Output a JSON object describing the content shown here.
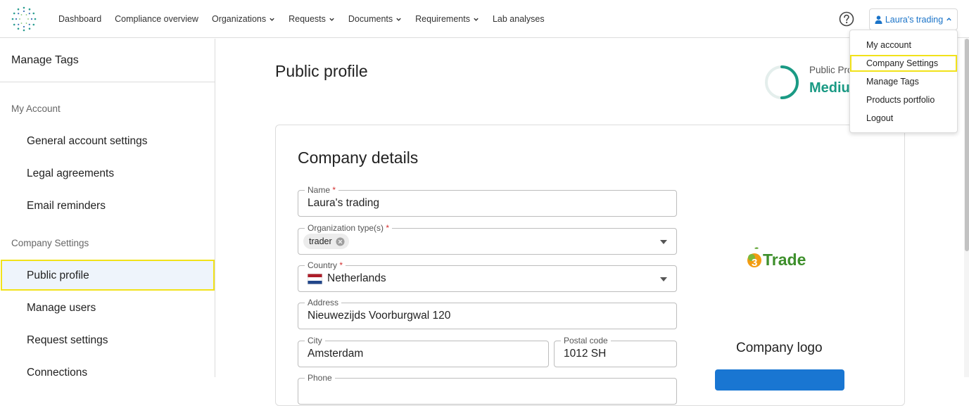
{
  "nav": {
    "items": [
      {
        "label": "Dashboard",
        "has_menu": false
      },
      {
        "label": "Compliance overview",
        "has_menu": false
      },
      {
        "label": "Organizations",
        "has_menu": true
      },
      {
        "label": "Requests",
        "has_menu": true
      },
      {
        "label": "Documents",
        "has_menu": true
      },
      {
        "label": "Requirements",
        "has_menu": true
      },
      {
        "label": "Lab analyses",
        "has_menu": false
      }
    ],
    "account_label": "Laura's trading"
  },
  "account_menu": {
    "items": [
      "My account",
      "Company Settings",
      "Manage Tags",
      "Products portfolio",
      "Logout"
    ],
    "highlighted": "Company Settings"
  },
  "sidebar": {
    "title": "Manage Tags",
    "section_my_account": "My Account",
    "my_account_items": [
      "General account settings",
      "Legal agreements",
      "Email reminders"
    ],
    "section_company": "Company Settings",
    "company_items": [
      "Public profile",
      "Manage users",
      "Request settings",
      "Connections"
    ],
    "active": "Public profile"
  },
  "main": {
    "title": "Public profile",
    "profile_strength_label": "Public Pro",
    "profile_strength_value": "Mediu",
    "profile_strength_fraction": 0.5
  },
  "card": {
    "title": "Company details",
    "name": {
      "label": "Name",
      "value": "Laura's trading"
    },
    "org_type": {
      "label": "Organization type(s)",
      "chip": "trader"
    },
    "country": {
      "label": "Country",
      "value": "Netherlands"
    },
    "address": {
      "label": "Address",
      "value": "Nieuwezijds Voorburgwal 120"
    },
    "city": {
      "label": "City",
      "value": "Amsterdam"
    },
    "postal": {
      "label": "Postal code",
      "value": "1012 SH"
    },
    "phone": {
      "label": "Phone"
    },
    "logo_text": "Trade",
    "logo_caption": "Company logo"
  },
  "colors": {
    "accent": "#1a73c8",
    "highlight": "#f2e21a",
    "gauge": "#1a9a84"
  }
}
